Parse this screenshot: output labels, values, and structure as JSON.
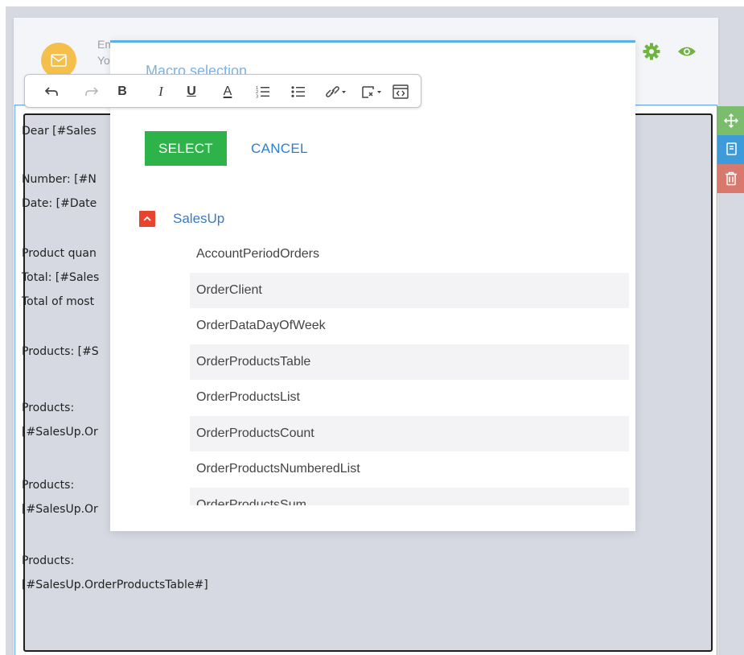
{
  "header": {
    "line1": "Em",
    "line2": "Yo"
  },
  "modal": {
    "title": "Macro selection",
    "select_label": "SELECT",
    "cancel_label": "CANCEL",
    "tree": {
      "root_label": "SalesUp",
      "items": [
        "AccountPeriodOrders",
        "OrderClient",
        "OrderDataDayOfWeek",
        "OrderProductsTable",
        "OrderProductsList",
        "OrderProductsCount",
        "OrderProductsNumberedList",
        "OrderProductsSum"
      ]
    }
  },
  "editor": {
    "lines": [
      "Dear [#Sales",
      "Number: [#N",
      "Date: [#Date",
      "Product quan",
      "Total: [#Sales",
      "Total of most",
      "Products: [#S",
      "Products:",
      "[#SalesUp.Or",
      "Products:",
      "[#SalesUp.Or",
      "Products:",
      "[#SalesUp.OrderProductsTable#]"
    ]
  },
  "toolbar": {
    "bold": "B",
    "italic": "I",
    "underline": "U",
    "color": "A"
  },
  "icons": {
    "avatar": "envelope-icon",
    "gear": "gear-icon",
    "eye": "eye-icon",
    "move": "move-icon",
    "copy": "copy-icon",
    "delete": "trash-icon"
  },
  "colors": {
    "select_button": "#2db34a",
    "cancel_link": "#2b7fd1",
    "tree_toggle": "#e7432f",
    "gear": "#6fb43f",
    "accent_blue": "#5ab2e6"
  }
}
